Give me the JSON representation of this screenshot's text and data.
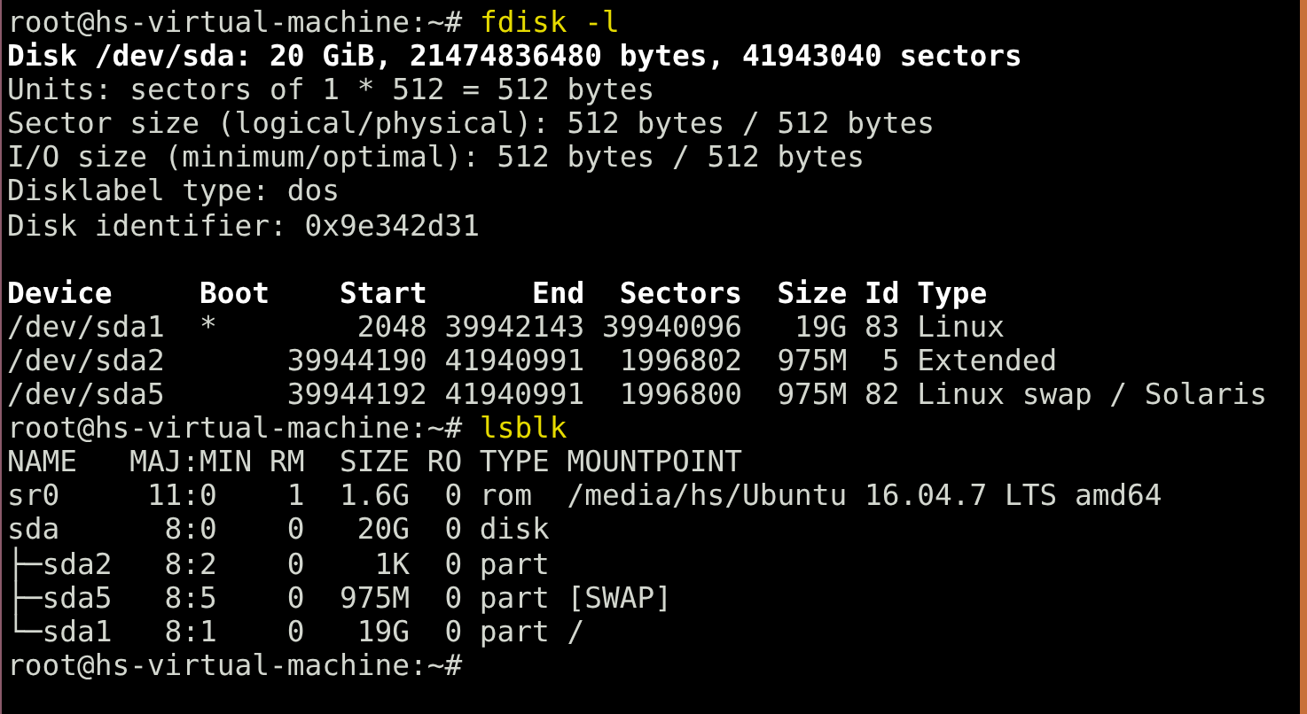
{
  "terminal": {
    "lines": [
      {
        "kind": "prompt",
        "prompt": "root@hs-virtual-machine:~#",
        "command": "fdisk -l"
      },
      {
        "kind": "bold",
        "text": "Disk /dev/sda: 20 GiB, 21474836480 bytes, 41943040 sectors"
      },
      {
        "kind": "plain",
        "text": "Units: sectors of 1 * 512 = 512 bytes"
      },
      {
        "kind": "plain",
        "text": "Sector size (logical/physical): 512 bytes / 512 bytes"
      },
      {
        "kind": "plain",
        "text": "I/O size (minimum/optimal): 512 bytes / 512 bytes"
      },
      {
        "kind": "plain",
        "text": "Disklabel type: dos"
      },
      {
        "kind": "plain",
        "text": "Disk identifier: 0x9e342d31"
      },
      {
        "kind": "blank"
      },
      {
        "kind": "bold",
        "text": "Device     Boot    Start      End  Sectors  Size Id Type"
      },
      {
        "kind": "plain",
        "text": "/dev/sda1  *        2048 39942143 39940096   19G 83 Linux"
      },
      {
        "kind": "plain",
        "text": "/dev/sda2       39944190 41940991  1996802  975M  5 Extended"
      },
      {
        "kind": "plain",
        "text": "/dev/sda5       39944192 41940991  1996800  975M 82 Linux swap / Solaris"
      },
      {
        "kind": "prompt",
        "prompt": "root@hs-virtual-machine:~#",
        "command": "lsblk"
      },
      {
        "kind": "plain",
        "text": "NAME   MAJ:MIN RM  SIZE RO TYPE MOUNTPOINT"
      },
      {
        "kind": "plain",
        "text": "sr0     11:0    1  1.6G  0 rom  /media/hs/Ubuntu 16.04.7 LTS amd64"
      },
      {
        "kind": "plain",
        "text": "sda      8:0    0   20G  0 disk"
      },
      {
        "kind": "plain",
        "text": "├─sda2   8:2    0    1K  0 part"
      },
      {
        "kind": "plain",
        "text": "├─sda5   8:5    0  975M  0 part [SWAP]"
      },
      {
        "kind": "plain",
        "text": "└─sda1   8:1    0   19G  0 part /"
      },
      {
        "kind": "prompt",
        "prompt": "root@hs-virtual-machine:~#"
      }
    ]
  }
}
